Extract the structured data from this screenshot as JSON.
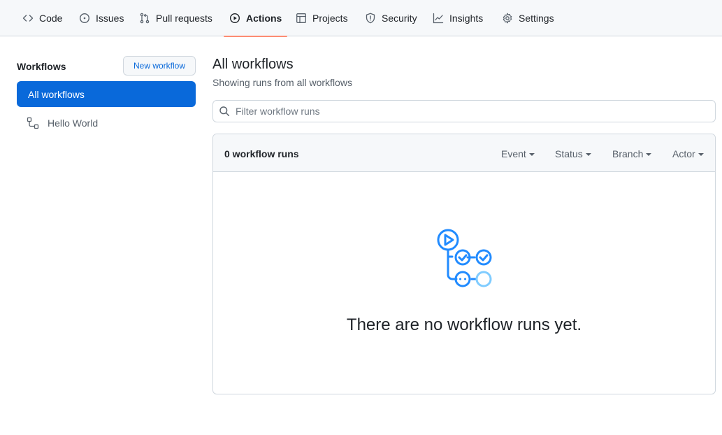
{
  "nav": {
    "tabs": [
      {
        "label": "Code",
        "icon": "code-icon"
      },
      {
        "label": "Issues",
        "icon": "issue-opened-icon"
      },
      {
        "label": "Pull requests",
        "icon": "git-pull-request-icon"
      },
      {
        "label": "Actions",
        "icon": "play-icon",
        "active": true
      },
      {
        "label": "Projects",
        "icon": "table-icon"
      },
      {
        "label": "Security",
        "icon": "shield-icon"
      },
      {
        "label": "Insights",
        "icon": "graph-icon"
      },
      {
        "label": "Settings",
        "icon": "gear-icon"
      }
    ],
    "active_underline_color": "#fd8c73"
  },
  "sidebar": {
    "title": "Workflows",
    "new_workflow_label": "New workflow",
    "items": [
      {
        "label": "All workflows",
        "selected": true
      },
      {
        "label": "Hello World",
        "icon": "workflow-icon"
      }
    ],
    "selected_color": "#0969da"
  },
  "main": {
    "title": "All workflows",
    "subtitle": "Showing runs from all workflows",
    "filter_placeholder": "Filter workflow runs",
    "runs_count": "0 workflow runs",
    "filters": [
      "Event",
      "Status",
      "Branch",
      "Actor"
    ],
    "empty_message": "There are no workflow runs yet.",
    "illustration_color": "#218bff"
  }
}
